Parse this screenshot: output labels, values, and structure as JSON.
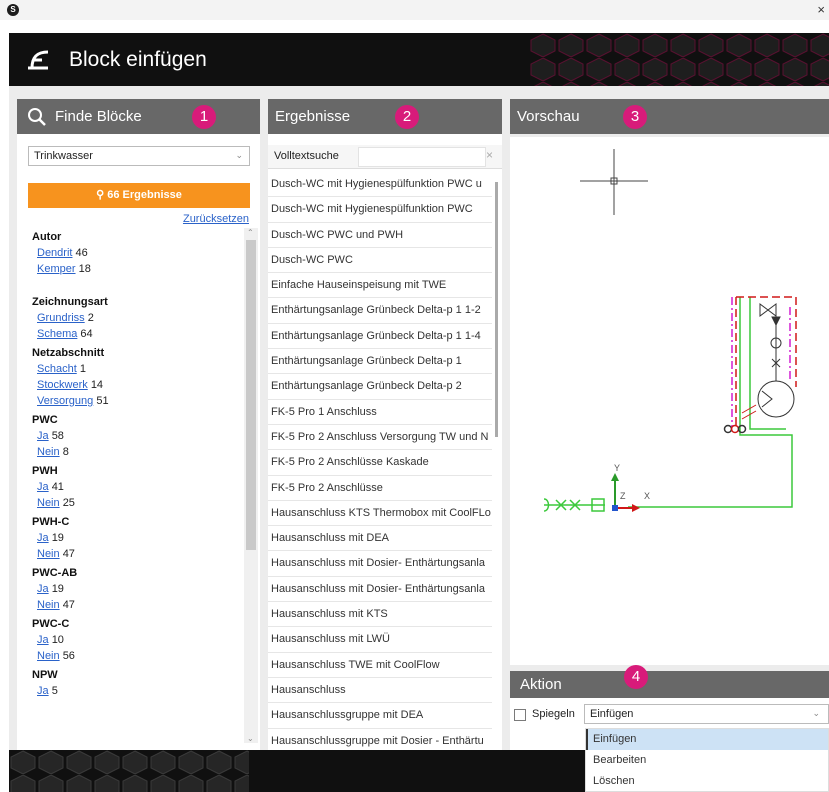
{
  "window": {
    "app_icon": "S",
    "close_glyph": "×"
  },
  "header": {
    "title": "Block einfügen"
  },
  "panels": {
    "left": {
      "title": "Finde Blöcke",
      "badge": "1"
    },
    "middle": {
      "title": "Ergebnisse",
      "badge": "2"
    },
    "right": {
      "title": "Vorschau",
      "badge": "3"
    },
    "action": {
      "title": "Aktion",
      "badge": "4"
    }
  },
  "filter": {
    "selected": "Trinkwasser",
    "results_button": "66 Ergebnisse",
    "reset_link": "Zurücksetzen"
  },
  "facets": [
    {
      "title": "Autor",
      "items": [
        {
          "label": "Dendrit",
          "count": "46"
        },
        {
          "label": "Kemper",
          "count": "18"
        }
      ]
    },
    {
      "title": "Zeichnungsart",
      "items": [
        {
          "label": "Grundriss",
          "count": "2"
        },
        {
          "label": "Schema",
          "count": "64"
        }
      ]
    },
    {
      "title": "Netzabschnitt",
      "items": [
        {
          "label": "Schacht",
          "count": "1"
        },
        {
          "label": "Stockwerk",
          "count": "14"
        },
        {
          "label": "Versorgung",
          "count": "51"
        }
      ]
    },
    {
      "title": "PWC",
      "items": [
        {
          "label": "Ja",
          "count": "58"
        },
        {
          "label": "Nein",
          "count": "8"
        }
      ]
    },
    {
      "title": "PWH",
      "items": [
        {
          "label": "Ja",
          "count": "41"
        },
        {
          "label": "Nein",
          "count": "25"
        }
      ]
    },
    {
      "title": "PWH-C",
      "items": [
        {
          "label": "Ja",
          "count": "19"
        },
        {
          "label": "Nein",
          "count": "47"
        }
      ]
    },
    {
      "title": "PWC-AB",
      "items": [
        {
          "label": "Ja",
          "count": "19"
        },
        {
          "label": "Nein",
          "count": "47"
        }
      ]
    },
    {
      "title": "PWC-C",
      "items": [
        {
          "label": "Ja",
          "count": "10"
        },
        {
          "label": "Nein",
          "count": "56"
        }
      ]
    },
    {
      "title": "NPW",
      "items": [
        {
          "label": "Ja",
          "count": "5"
        }
      ]
    }
  ],
  "search": {
    "label": "Volltextsuche",
    "value": "",
    "clear_glyph": "×"
  },
  "results": [
    "Dusch-WC mit Hygienespülfunktion PWC u",
    "Dusch-WC mit Hygienespülfunktion PWC",
    "Dusch-WC PWC und PWH",
    "Dusch-WC PWC",
    "Einfache Hauseinspeisung mit TWE",
    "Enthärtungsanlage Grünbeck Delta-p 1 1-2",
    "Enthärtungsanlage Grünbeck Delta-p 1 1-4",
    "Enthärtungsanlage Grünbeck Delta-p 1",
    "Enthärtungsanlage Grünbeck Delta-p 2",
    "FK-5 Pro 1 Anschluss",
    "FK-5 Pro 2 Anschluss Versorgung TW und N",
    "FK-5 Pro 2 Anschlüsse Kaskade",
    "FK-5 Pro 2 Anschlüsse",
    "Hausanschluss KTS Thermobox mit CoolFLo",
    "Hausanschluss mit DEA",
    "Hausanschluss mit Dosier- Enthärtungsanla",
    "Hausanschluss mit Dosier- Enthärtungsanla",
    "Hausanschluss mit KTS",
    "Hausanschluss mit LWÜ",
    "Hausanschluss TWE mit CoolFlow",
    "Hausanschluss",
    "Hausanschlussgruppe mit DEA",
    "Hausanschlussgruppe mit Dosier - Enthärtu"
  ],
  "preview": {
    "axis_y": "Y",
    "axis_z": "Z",
    "axis_x": "X"
  },
  "action": {
    "mirror_label": "Spiegeln",
    "mirror_checked": false,
    "selected": "Einfügen",
    "options": [
      "Einfügen",
      "Bearbeiten",
      "Löschen"
    ]
  },
  "colors": {
    "accent": "#f7931e",
    "badge": "#d81b7a",
    "panel_header": "#686868",
    "link": "#2a62c9",
    "pipe_green": "#3cc93c",
    "pipe_magenta": "#d21ed2",
    "pipe_red": "#d01818"
  }
}
